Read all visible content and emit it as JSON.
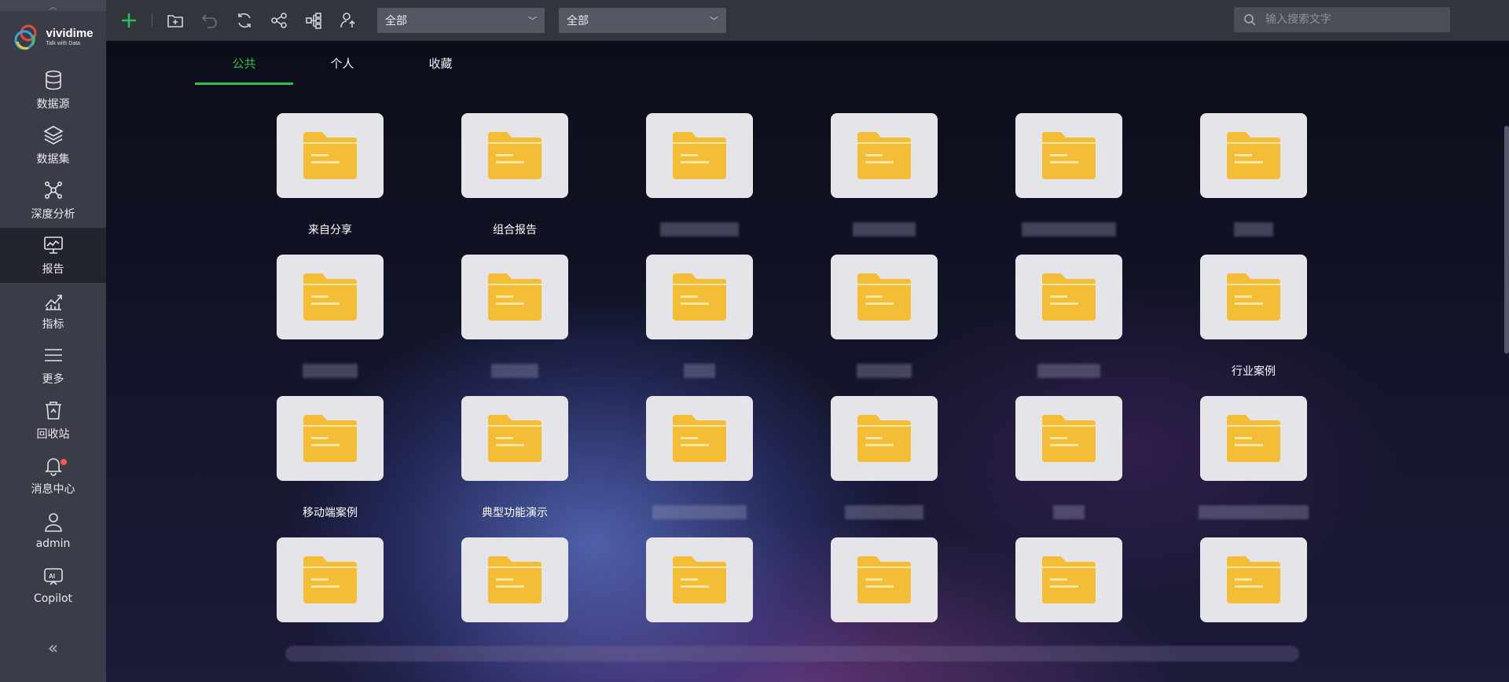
{
  "app": {
    "brand_name": "vividime",
    "brand_tagline": "Talk with Data"
  },
  "sidebar": {
    "items": [
      {
        "label": "数据源",
        "icon": "database-icon"
      },
      {
        "label": "数据集",
        "icon": "layers-icon"
      },
      {
        "label": "深度分析",
        "icon": "network-icon"
      },
      {
        "label": "报告",
        "icon": "monitor-chart-icon"
      },
      {
        "label": "指标",
        "icon": "trend-icon"
      },
      {
        "label": "更多",
        "icon": "menu-icon"
      },
      {
        "label": "回收站",
        "icon": "trash-icon"
      },
      {
        "label": "消息中心",
        "icon": "bell-icon"
      },
      {
        "label": "admin",
        "icon": "user-icon"
      },
      {
        "label": "Copilot",
        "icon": "ai-icon"
      }
    ],
    "collapse_glyph": "«"
  },
  "toolbar": {
    "select1": "全部",
    "select2": "全部",
    "search_placeholder": "输入搜索文字"
  },
  "tabs": [
    "公共",
    "个人",
    "收藏"
  ],
  "folders": [
    {
      "label": "来自分享"
    },
    {
      "label": "组合报告"
    },
    {
      "label": ""
    },
    {
      "label": ""
    },
    {
      "label": ""
    },
    {
      "label": ""
    },
    {
      "label": ""
    },
    {
      "label": ""
    },
    {
      "label": ""
    },
    {
      "label": ""
    },
    {
      "label": ""
    },
    {
      "label": "行业案例"
    },
    {
      "label": "移动端案例"
    },
    {
      "label": "典型功能演示"
    },
    {
      "label": ""
    },
    {
      "label": ""
    },
    {
      "label": ""
    },
    {
      "label": ""
    },
    {
      "label": ""
    },
    {
      "label": ""
    },
    {
      "label": ""
    },
    {
      "label": ""
    },
    {
      "label": ""
    },
    {
      "label": ""
    }
  ],
  "colors": {
    "accent": "#2bbd56",
    "folder": "#f4bd36",
    "sidebar": "#3a3d47",
    "toolbar": "#33353d"
  }
}
